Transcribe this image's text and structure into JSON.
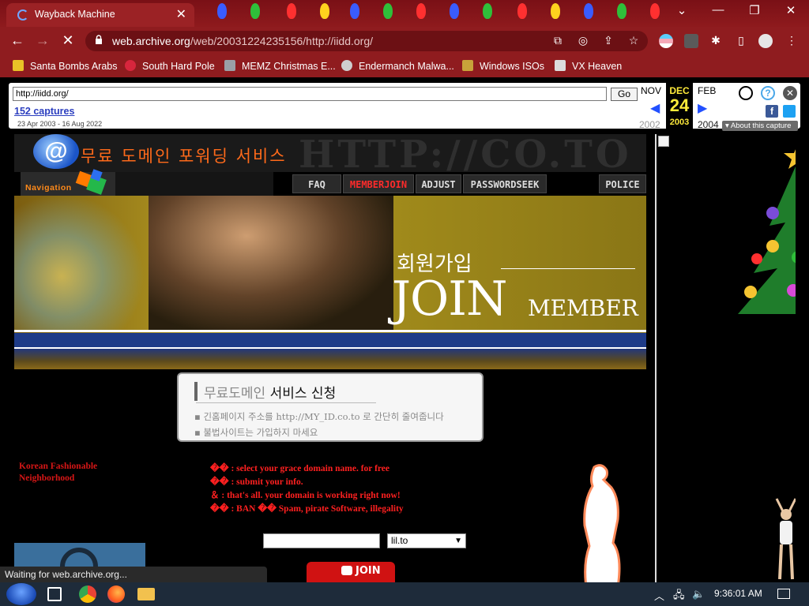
{
  "tab": {
    "title": "Wayback Machine",
    "close": "✕"
  },
  "window": {
    "min": "—",
    "restore": "❐",
    "close": "✕",
    "list": "⌄"
  },
  "nav": {
    "back": "←",
    "forward": "→",
    "stop": "✕",
    "url_host": "web.archive.org",
    "url_path": "/web/20031224235156/http://iidd.org/"
  },
  "bookmarks": [
    {
      "label": "Santa Bombs Arabs",
      "color": "#e9c227"
    },
    {
      "label": "South Hard Pole",
      "color": "#d7263d"
    },
    {
      "label": "MEMZ Christmas E...",
      "color": "#9aa0a6"
    },
    {
      "label": "Endermanch Malwa...",
      "color": "#cfcfcf"
    },
    {
      "label": "Windows ISOs",
      "color": "#c8a33a"
    },
    {
      "label": "VX Heaven",
      "color": "#dcdcdc"
    }
  ],
  "wayback": {
    "url_value": "http://iidd.org/",
    "go": "Go",
    "captures": "152 captures",
    "range": "23 Apr 2003 - 16 Aug 2022",
    "prev_month": "NOV",
    "prev_year": "2002",
    "cur_month": "DEC",
    "cur_day": "24",
    "cur_year": "2003",
    "next_month": "FEB",
    "next_year": "2004",
    "about": "About this capture"
  },
  "site": {
    "header_title": "무료 도메인 포워딩 서비스",
    "header_ghost": "HTTP://CO.TO",
    "nav_logo": "Navigation",
    "nav": [
      "FAQ",
      "MEMBERJOIN",
      "ADJUST",
      "PASSWORDSEEK",
      "POLICE"
    ],
    "nav_active": "MEMBERJOIN",
    "banner_korean": "회원가입",
    "banner_join": "JOIN",
    "banner_member": "MEMBER",
    "service_title_gray": "무료도메인",
    "service_title_dark": "서비스 신청",
    "service_items": [
      "긴홈페이지 주소를 http://MY_ID.co.to 로 간단히 줄여줍니다",
      "불법사이트는 가입하지 마세요"
    ],
    "fashion_line1": "Korean Fashionable",
    "fashion_line2": "Neighborhood",
    "steps": [
      "�� : select your grace domain name. for free",
      "�� : submit your info.",
      "＆ : that's all. your domain is working right now!",
      "�� : BAN �� Spam, pirate Software, illegality"
    ],
    "domain_selected": "lil.to",
    "join_btn": "JOIN"
  },
  "status_text": "Waiting for web.archive.org...",
  "taskbar": {
    "clock": "9:36:01 AM"
  }
}
